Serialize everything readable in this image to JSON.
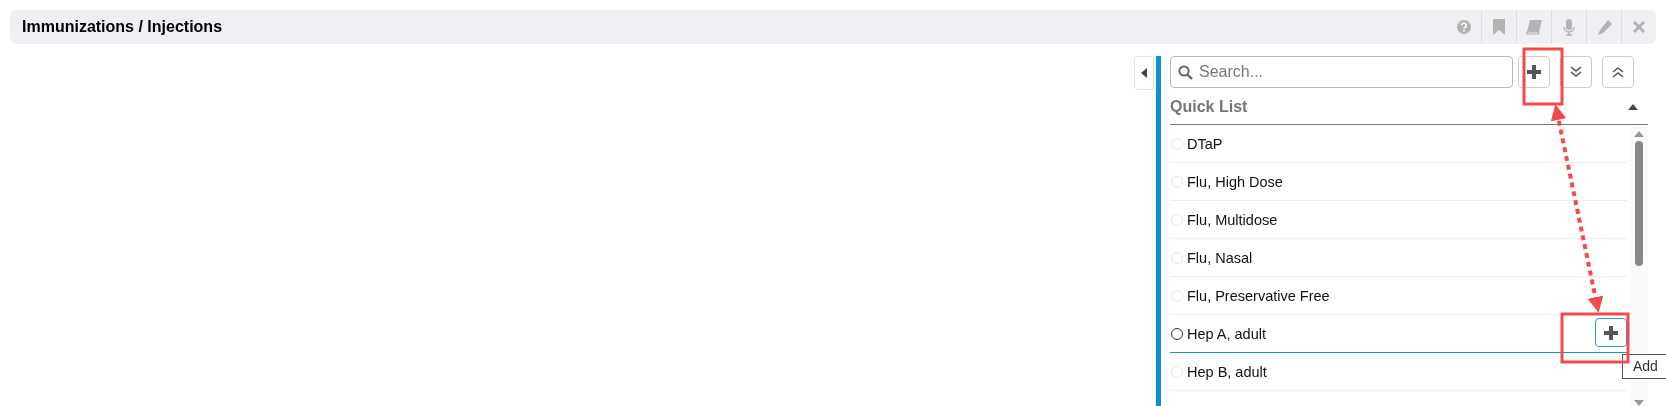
{
  "header": {
    "title": "Immunizations / Injections"
  },
  "search": {
    "placeholder": "Search..."
  },
  "quick_list": {
    "title": "Quick List",
    "expanded": true,
    "items": [
      {
        "label": "DTaP",
        "highlighted": false
      },
      {
        "label": "Flu, High Dose",
        "highlighted": false
      },
      {
        "label": "Flu, Multidose",
        "highlighted": false
      },
      {
        "label": "Flu, Nasal",
        "highlighted": false
      },
      {
        "label": "Flu, Preservative Free",
        "highlighted": false
      },
      {
        "label": "Hep A, adult",
        "highlighted": true
      },
      {
        "label": "Hep B, adult",
        "highlighted": false
      }
    ]
  },
  "tooltip": "Add"
}
